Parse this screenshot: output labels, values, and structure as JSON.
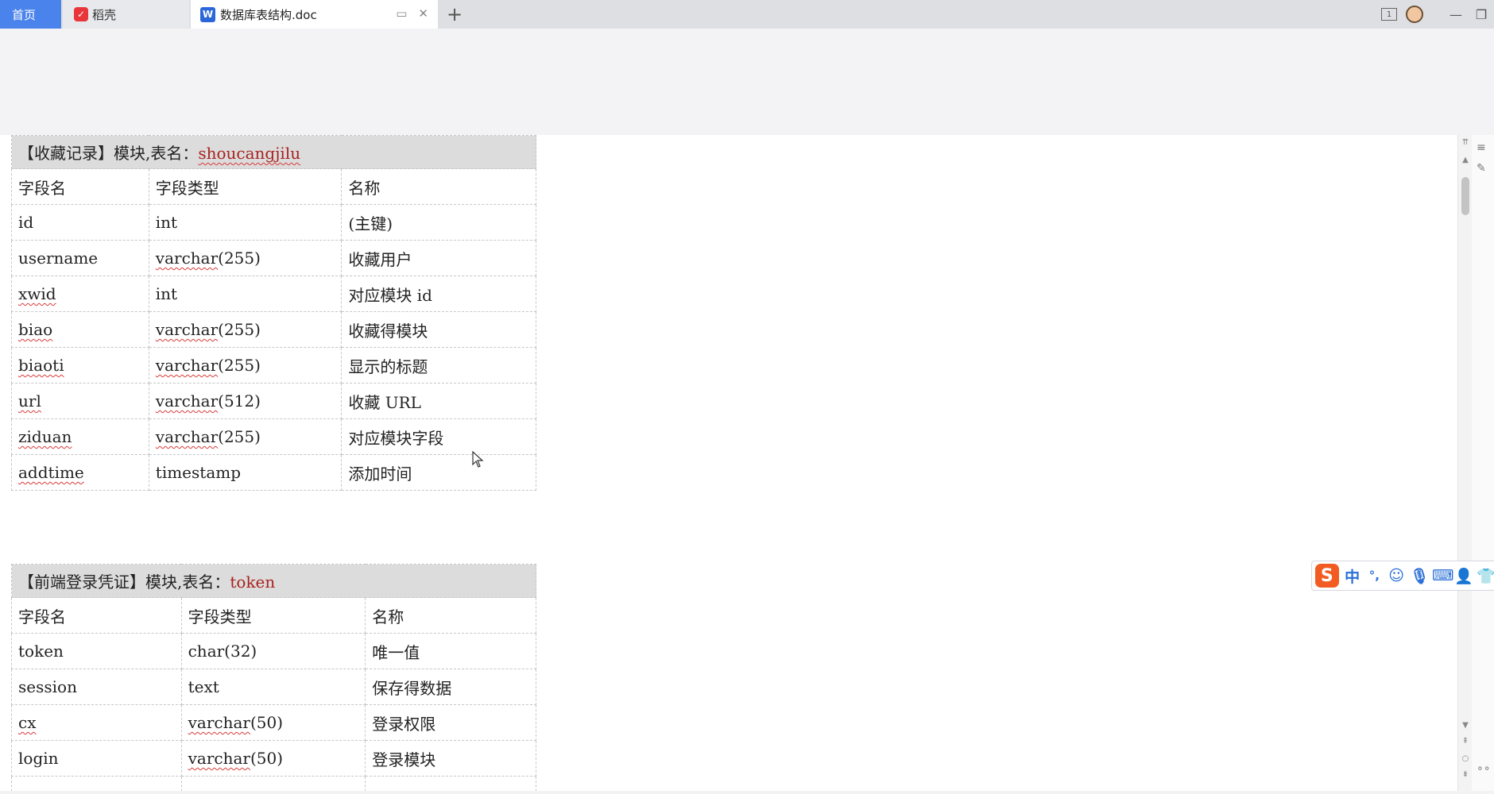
{
  "tabs": {
    "home": "首页",
    "daoke": "稻壳",
    "doc": "数据库表结构.doc"
  },
  "toolbar_icons": [
    "restore-icon",
    "close-icon",
    "plus-icon",
    "layout-icon",
    "avatar",
    "minimize-icon",
    "maximize-icon"
  ],
  "tables": [
    {
      "prefix": "【收藏记录】模块,表名：",
      "name": "shoucangjilu",
      "headers": [
        "字段名",
        "字段类型",
        "名称"
      ],
      "rows": [
        [
          "id",
          "int",
          "(主键)"
        ],
        [
          "username",
          "varchar(255)",
          "收藏用户"
        ],
        [
          "xwid",
          "int",
          "对应模块 id"
        ],
        [
          "biao",
          "varchar(255)",
          "收藏得模块"
        ],
        [
          "biaoti",
          "varchar(255)",
          "显示的标题"
        ],
        [
          "url",
          "varchar(512)",
          "收藏 URL"
        ],
        [
          "ziduan",
          "varchar(255)",
          "对应模块字段"
        ],
        [
          "addtime",
          "timestamp",
          "添加时间"
        ]
      ]
    },
    {
      "prefix": "【前端登录凭证】模块,表名：",
      "name": "token",
      "headers": [
        "字段名",
        "字段类型",
        "名称"
      ],
      "rows": [
        [
          "token",
          "char(32)",
          "唯一值"
        ],
        [
          "session",
          "text",
          "保存得数据"
        ],
        [
          "cx",
          "varchar(50)",
          "登录权限"
        ],
        [
          "login",
          "varchar(50)",
          "登录模块"
        ]
      ]
    }
  ],
  "ime": {
    "logo": "S",
    "mode": "中",
    "punct": "°,"
  }
}
